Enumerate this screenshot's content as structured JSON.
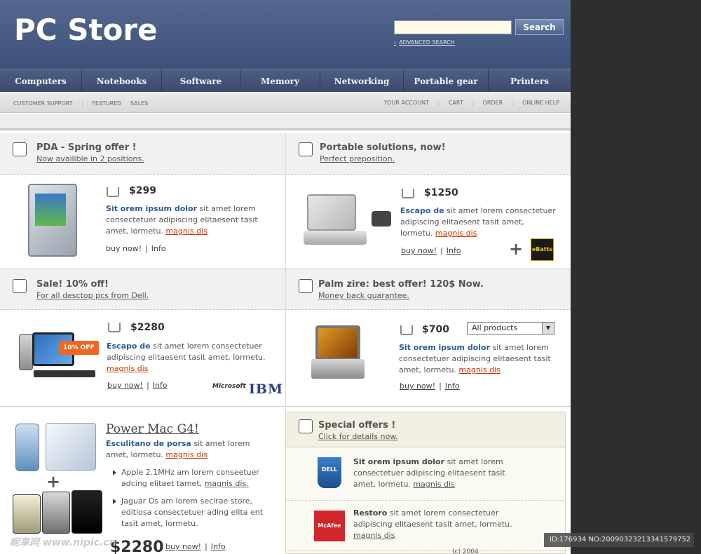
{
  "header": {
    "logo": "PC Store",
    "search_label": "Search",
    "search_value": "",
    "advanced_search": "ADVANCED SEARCH"
  },
  "nav": [
    "Computers",
    "Notebooks",
    "Software",
    "Memory",
    "Networking",
    "Portable gear",
    "Printers"
  ],
  "subnav": {
    "left": [
      "CUSTOMER SUPPORT",
      ":",
      "FEATURED",
      "SALES"
    ],
    "right": [
      "YOUR ACCOUNT",
      ":",
      "CART",
      ":",
      "ORDER",
      ":",
      "ONLINE HELP"
    ]
  },
  "cells": {
    "pda": {
      "title": "PDA - Spring offer !",
      "subtitle": "Now availible in 2 positions.",
      "price": "$299",
      "desc_bold": "Sit orem ipsum dolor",
      "desc_text": " sit amet lorem consectetuer adipiscing elitaesent tasit amet, lormetu. ",
      "desc_link": "magnis dis",
      "buy": "buy now!",
      "info": "Info"
    },
    "portable": {
      "title": "Portable solutions, now!",
      "subtitle": "Perfect preposition.",
      "price": "$1250",
      "desc_bold": "Escapo de",
      "desc_text": " sit amet lorem consectetuer adipiscing elitaesent tasit amet, lormetu. ",
      "desc_link": "magnis dis",
      "buy": "buy now!",
      "info": "Info",
      "ebatts": "eBatts"
    },
    "sale": {
      "title": "Sale! 10% off!",
      "subtitle": "For all desctop pcs from Dell.",
      "price": "$2280",
      "badge": "10% OFF",
      "desc_bold": "Escapo de",
      "desc_text": " sit amet lorem consectetuer adipiscing elitaesent tasit amet, lormetu. ",
      "desc_link": "magnis dis",
      "buy": "buy now!",
      "info": "Info",
      "logo_ms": "Microsoft",
      "logo_ibm": "IBM"
    },
    "palm": {
      "title": "Palm zire: best offer! 120$ Now.",
      "subtitle": "Money back guarantee.",
      "price": "$700",
      "select_value": "All products",
      "desc_bold": "Sit orem ipsum dolor",
      "desc_text": " sit amet lorem consectetuer adipiscing elitaesent tasit amet, lormetu. ",
      "desc_link": "magnis dis",
      "buy": "buy now!",
      "info": "Info"
    },
    "powermac": {
      "title": "Power Mac G4!",
      "desc_bold": "Esculitano de porsa",
      "desc_text": " sit amet lorem amet, lormetu. ",
      "desc_link": "magnis dis",
      "bullet1_text": "Apple 2.1MHz am lorem conseetuer adcing elitaet tamet, ",
      "bullet1_link": "magnis dis.",
      "bullet2_text": "Jaguar Os am lorem secirae store, editiosa consectetuer ading elita ent tasit amet, lormetu.",
      "price": "$2280",
      "buy": "buy now!",
      "info": "Info"
    }
  },
  "special": {
    "title": "Special offers !",
    "subtitle": "Click for details now.",
    "row1_bold": "Sit orem ipsum dolor",
    "row1_text": " sit amet lorem consectetuer adipiscing elitaesent tasit amet, lormetu. ",
    "row1_link": "magnis dis",
    "row1_logo": "DELL",
    "row2_bold": "Restoro",
    "row2_text": " sit amet lorem consectetuer adipiscing elitaesent tasit amet, lormetu. ",
    "row2_link": "magnis dis",
    "row2_logo": "McAfee"
  },
  "footer": {
    "copyright": "(c) 2004"
  },
  "overlays": {
    "watermark": "昵享网 www.nipic.cn",
    "image_id": "ID:176934 NO:20090323213341579752"
  }
}
